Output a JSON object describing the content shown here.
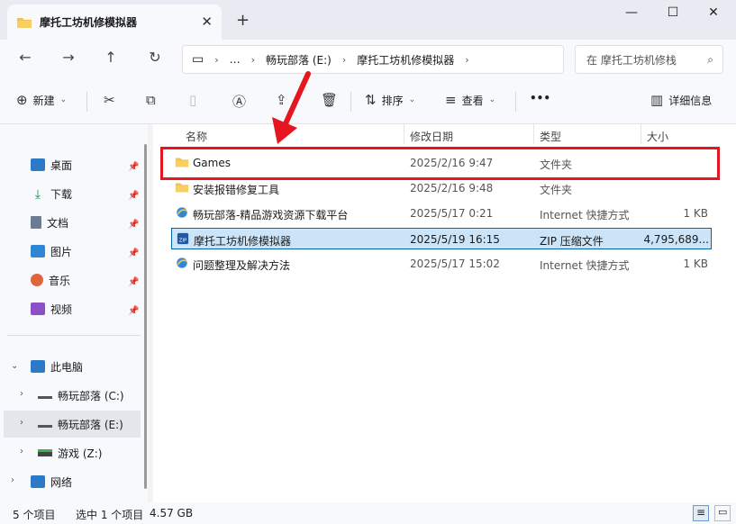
{
  "tab": {
    "title": "摩托工坊机修模拟器",
    "close": "✕"
  },
  "window": {
    "new_tab": "+",
    "minimize": "—",
    "maximize": "☐",
    "close": "✕"
  },
  "nav": {
    "back": "←",
    "forward": "→",
    "up": "↑",
    "refresh": "↻"
  },
  "address": {
    "pc": "▭",
    "more": "…",
    "crumbs": [
      "畅玩部落 (E:)",
      "摩托工坊机修模拟器"
    ],
    "sep": "›"
  },
  "search": {
    "placeholder": "在 摩托工坊机修栈",
    "icon": "⌕"
  },
  "toolbar": {
    "new_label": "新建",
    "sort_label": "排序",
    "view_label": "查看",
    "more_label": "•••",
    "details_label": "详细信息"
  },
  "sidebar": {
    "quick": [
      {
        "label": "桌面",
        "icon": "desktop-icon",
        "color": "#2a7ac7"
      },
      {
        "label": "下载",
        "icon": "download-icon",
        "color": "#1a8f4a"
      },
      {
        "label": "文档",
        "icon": "document-icon",
        "color": "#6b7c93"
      },
      {
        "label": "图片",
        "icon": "picture-icon",
        "color": "#2f86d4"
      },
      {
        "label": "音乐",
        "icon": "music-icon",
        "color": "#e0653a"
      },
      {
        "label": "视频",
        "icon": "video-icon",
        "color": "#8b4fc7"
      }
    ],
    "this_pc": "此电脑",
    "drives": [
      {
        "label": "畅玩部落 (C:)"
      },
      {
        "label": "畅玩部落 (E:)"
      },
      {
        "label": "游戏 (Z:)"
      }
    ],
    "network": "网络"
  },
  "columns": {
    "name": "名称",
    "date": "修改日期",
    "type": "类型",
    "size": "大小"
  },
  "files": [
    {
      "name": "Games",
      "date": "2025/2/16 9:47",
      "type": "文件夹",
      "size": "",
      "icon": "folder"
    },
    {
      "name": "安装报错修复工具",
      "date": "2025/2/16 9:48",
      "type": "文件夹",
      "size": "",
      "icon": "folder"
    },
    {
      "name": "畅玩部落-精品游戏资源下载平台",
      "date": "2025/5/17 0:21",
      "type": "Internet 快捷方式",
      "size": "1 KB",
      "icon": "url"
    },
    {
      "name": "摩托工坊机修模拟器",
      "date": "2025/5/19 16:15",
      "type": "ZIP 压缩文件",
      "size": "4,795,689...",
      "icon": "zip"
    },
    {
      "name": "问题整理及解决方法",
      "date": "2025/5/17 15:02",
      "type": "Internet 快捷方式",
      "size": "1 KB",
      "icon": "url"
    }
  ],
  "status": {
    "count": "5 个项目",
    "selected": "选中 1 个项目",
    "size": "4.57 GB"
  },
  "colors": {
    "accent": "#0a64a4",
    "selection": "#cce4f7",
    "highlight": "#e5161f",
    "folder": "#f4c04e"
  }
}
